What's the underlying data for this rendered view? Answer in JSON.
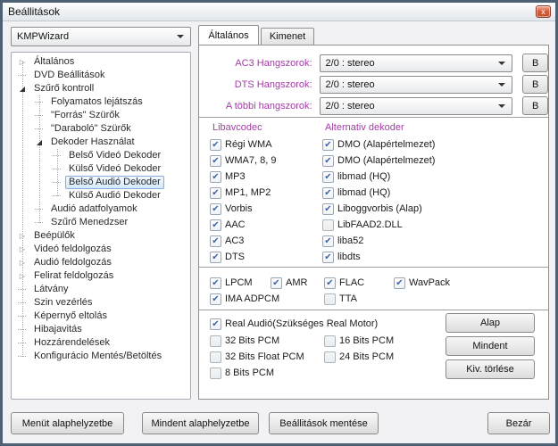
{
  "window": {
    "title": "Beállitások"
  },
  "titlebar": {
    "close_glyph": "x"
  },
  "profile_combo": {
    "value": "KMPWizard"
  },
  "tree": {
    "items": [
      {
        "label": "Általános",
        "level": 0,
        "expander": "collapsed"
      },
      {
        "label": "DVD Beállitások",
        "level": 0
      },
      {
        "label": "Szűrő kontroll",
        "level": 0,
        "expander": "expanded"
      },
      {
        "label": "Folyamatos lejátszás",
        "level": 1
      },
      {
        "label": "\"Forrás\" Szürők",
        "level": 1
      },
      {
        "label": "\"Daraboló\" Szürők",
        "level": 1
      },
      {
        "label": "Dekoder Használat",
        "level": 1,
        "expander": "expanded"
      },
      {
        "label": "Belső Videó Dekoder",
        "level": 2
      },
      {
        "label": "Külső Videó Dekoder",
        "level": 2
      },
      {
        "label": "Belső Audió Dekoder",
        "level": 2,
        "selected": true
      },
      {
        "label": "Külső Audió Dekoder",
        "level": 2
      },
      {
        "label": "Audió adatfolyamok",
        "level": 1
      },
      {
        "label": "Szűrő Menedzser",
        "level": 1
      },
      {
        "label": "Beépülők",
        "level": 0,
        "expander": "collapsed"
      },
      {
        "label": "Videó feldolgozás",
        "level": 0,
        "expander": "collapsed"
      },
      {
        "label": "Audió feldolgozás",
        "level": 0,
        "expander": "collapsed"
      },
      {
        "label": "Felirat feldolgozás",
        "level": 0,
        "expander": "collapsed"
      },
      {
        "label": "Látvány",
        "level": 0
      },
      {
        "label": "Szin vezérlés",
        "level": 0
      },
      {
        "label": "Képernyő eltolás",
        "level": 0
      },
      {
        "label": "Hibajavitás",
        "level": 0
      },
      {
        "label": "Hozzárendelések",
        "level": 0
      },
      {
        "label": "Konfigurácio Mentés/Betöltés",
        "level": 0
      }
    ]
  },
  "tabs": [
    {
      "label": "Általános",
      "active": true
    },
    {
      "label": "Kimenet",
      "active": false
    }
  ],
  "speaker_rows": [
    {
      "label": "AC3 Hangszorok:",
      "value": "2/0 : stereo",
      "button": "B"
    },
    {
      "label": "DTS Hangszorok:",
      "value": "2/0 : stereo",
      "button": "B"
    },
    {
      "label": "A többi hangszorok:",
      "value": "2/0 : stereo",
      "button": "B"
    }
  ],
  "codec_columns": {
    "left": {
      "header": "Libavcodec",
      "items": [
        {
          "label": "Régi WMA",
          "checked": true
        },
        {
          "label": "WMA7, 8, 9",
          "checked": true
        },
        {
          "label": "MP3",
          "checked": true
        },
        {
          "label": "MP1, MP2",
          "checked": true
        },
        {
          "label": "Vorbis",
          "checked": true
        },
        {
          "label": "AAC",
          "checked": true
        },
        {
          "label": "AC3",
          "checked": true
        },
        {
          "label": "DTS",
          "checked": true
        }
      ]
    },
    "right": {
      "header": "Alternativ dekoder",
      "items": [
        {
          "label": "DMO (Alapértelmezet)",
          "checked": true
        },
        {
          "label": "DMO (Alapértelmezet)",
          "checked": true
        },
        {
          "label": "libmad (HQ)",
          "checked": true
        },
        {
          "label": "libmad (HQ)",
          "checked": true
        },
        {
          "label": "Liboggvorbis (Alap)",
          "checked": true
        },
        {
          "label": "LibFAAD2.DLL",
          "checked": false
        },
        {
          "label": "liba52",
          "checked": true
        },
        {
          "label": "libdts",
          "checked": true
        }
      ]
    }
  },
  "extra_codecs": {
    "rows": [
      [
        {
          "label": "LPCM",
          "checked": true
        },
        {
          "label": "AMR",
          "checked": true
        },
        {
          "label": "FLAC",
          "checked": true
        },
        {
          "label": "WavPack",
          "checked": true
        }
      ],
      [
        {
          "label": "IMA ADPCM",
          "checked": true
        },
        null,
        {
          "label": "TTA",
          "checked": false
        },
        null
      ]
    ]
  },
  "pcm_section": {
    "real_audio": {
      "label": "Real Audió(Szükséges Real Motor)",
      "checked": true
    },
    "rows": [
      [
        {
          "label": "32 Bits PCM",
          "checked": false
        },
        {
          "label": "16 Bits PCM",
          "checked": false
        }
      ],
      [
        {
          "label": "32 Bits Float PCM",
          "checked": false
        },
        {
          "label": "24 Bits PCM",
          "checked": false
        }
      ],
      [
        {
          "label": "8 Bits PCM",
          "checked": false
        },
        null
      ]
    ],
    "buttons": [
      "Alap",
      "Mindent",
      "Kiv. törlése"
    ]
  },
  "bottom_bar": {
    "buttons": [
      "Menüt alaphelyzetbe",
      "Mindent alaphelyzetbe",
      "Beállitások mentése"
    ],
    "close_label": "Bezár"
  },
  "colors": {
    "accent_label": "#a43ca6",
    "check_blue": "#3f63b5",
    "selection_bg": "#d4e9fa",
    "window_border": "#4e6074"
  }
}
